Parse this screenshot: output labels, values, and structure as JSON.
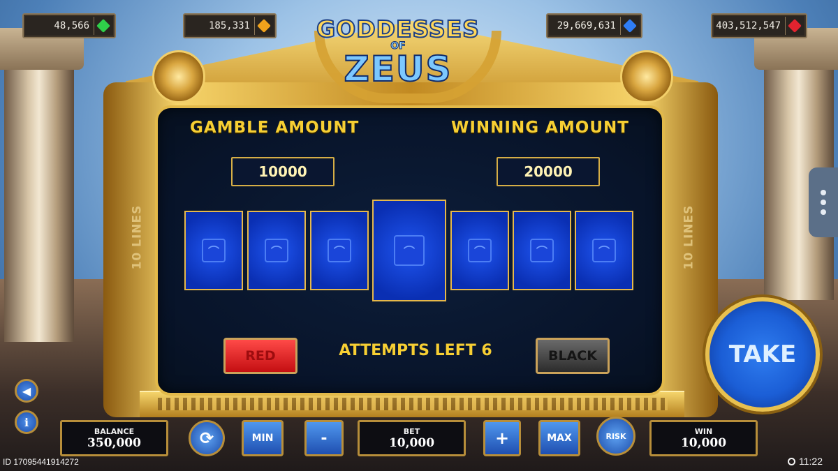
{
  "resources": [
    {
      "value": "48,566",
      "gem_color": "#2fcf4a",
      "icon": "green-gem-icon"
    },
    {
      "value": "185,331",
      "gem_color": "#f0a21c",
      "icon": "orange-gem-icon"
    },
    {
      "value": "29,669,631",
      "gem_color": "#2f7df5",
      "icon": "blue-gem-icon"
    },
    {
      "value": "403,512,547",
      "gem_color": "#e2232f",
      "icon": "red-gem-icon"
    }
  ],
  "logo": {
    "line1": "GODDESSES",
    "line2": "OF",
    "line3": "ZEUS"
  },
  "gamble": {
    "gamble_label": "GAMBLE AMOUNT",
    "gamble_value": "10000",
    "winning_label": "WINNING AMOUNT",
    "winning_value": "20000",
    "attempts_text": "ATTEMPTS LEFT 6",
    "red_label": "RED",
    "black_label": "BLACK"
  },
  "lines_label": "10 LINES",
  "take_label": "TAKE",
  "bottom": {
    "balance_label": "BALANCE",
    "balance_value": "350,000",
    "min_label": "MIN",
    "minus_label": "-",
    "bet_label": "BET",
    "bet_value": "10,000",
    "plus_label": "+",
    "max_label": "MAX",
    "risk_label": "RISK",
    "win_label": "WIN",
    "win_value": "10,000"
  },
  "footer": {
    "id_text": "ID 17095441914272",
    "time": "11:22"
  },
  "colors": {
    "accent_gold": "#f7cf33",
    "card_blue": "#0d36c8",
    "take_blue": "#1b5ed6"
  }
}
